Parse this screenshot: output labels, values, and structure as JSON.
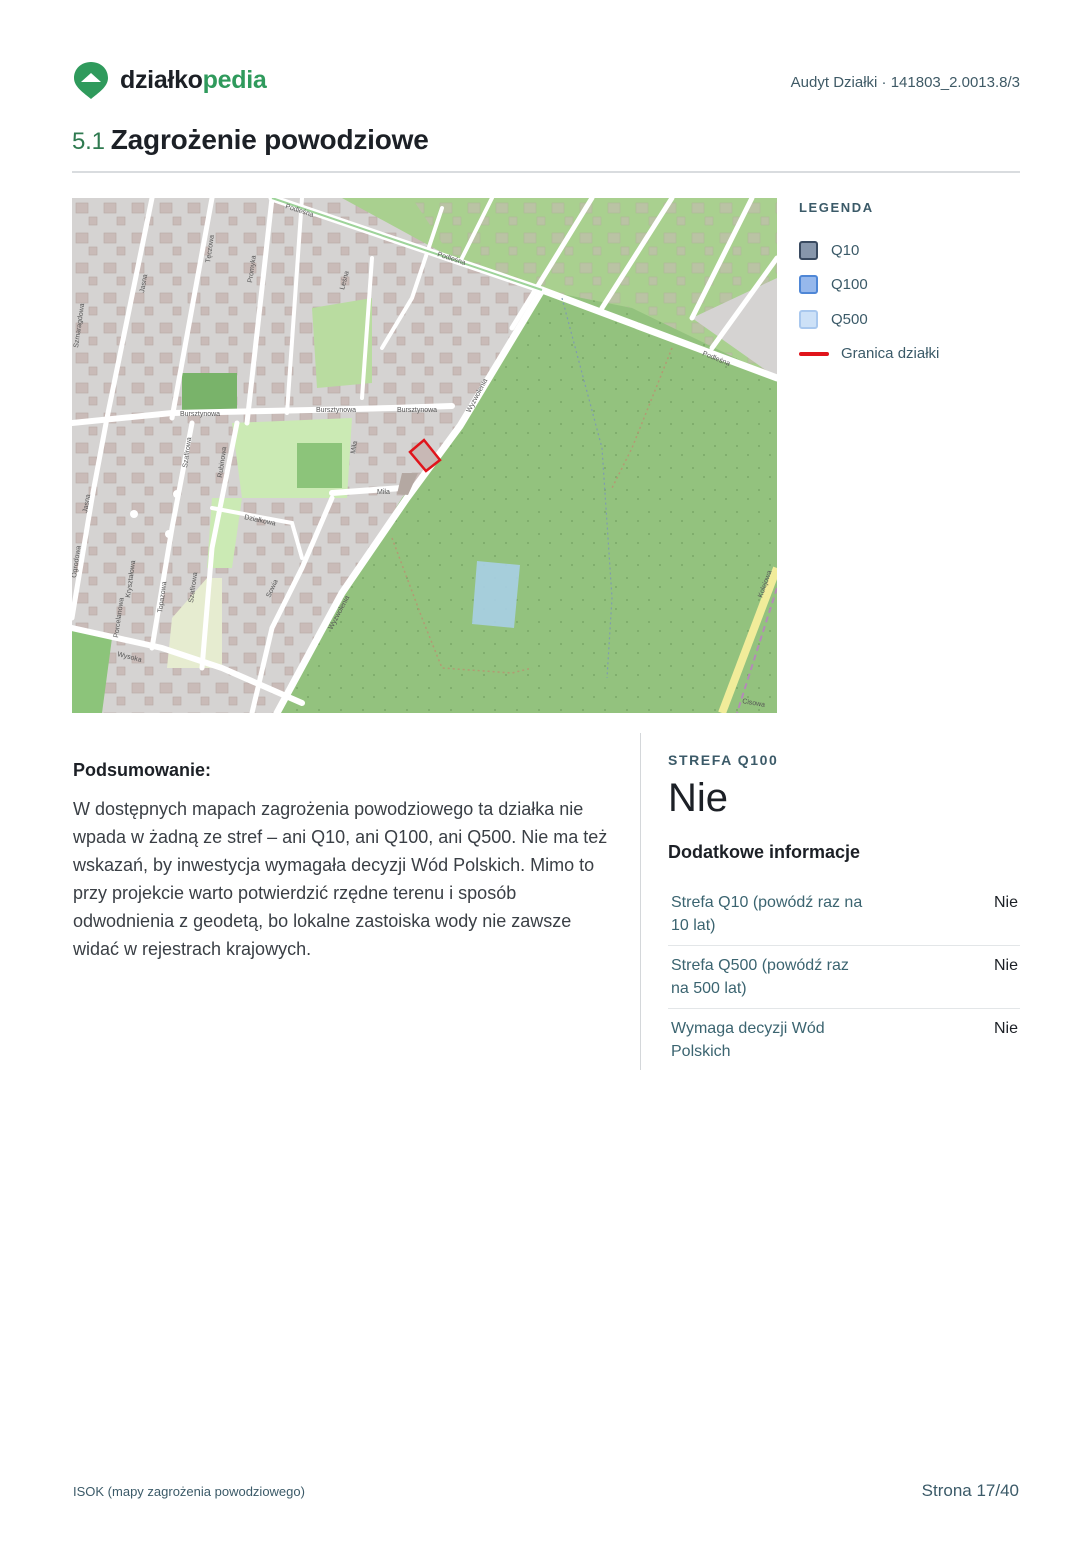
{
  "header": {
    "logo_part1": "działko",
    "logo_part2": "pedia",
    "doc_ref": "Audyt Działki · 141803_2.0013.8/3"
  },
  "section": {
    "number": "5.1",
    "title": "Zagrożenie powodziowe"
  },
  "map": {
    "street_labels": [
      "Podleśna",
      "Podleśna",
      "Podleśna",
      "Bursztynowa",
      "Bursztynowa",
      "Bursztynowa",
      "Miła",
      "Miła",
      "Działkowa",
      "Wysoka",
      "Wyzwolenia",
      "Wyzwolenia",
      "Szafirowa",
      "Szafirowa",
      "Topazowa",
      "Kryształowa",
      "Porcelanowa",
      "Jasna",
      "Jasna",
      "Promyka",
      "Tęczowa",
      "Rubinowa",
      "Sowia",
      "Szmaragdowa",
      "Kolejowa",
      "Leśna",
      "Cisowa",
      "Ogrodowa"
    ],
    "colors": {
      "forest": "#93c27e",
      "residential": "#d5d3d2",
      "road": "#ffffff",
      "parcel_border": "#e0141b",
      "water_zone": "#a9cfe6"
    }
  },
  "legend": {
    "title": "LEGENDA",
    "items": [
      {
        "label": "Q10",
        "color": "#8796ab"
      },
      {
        "label": "Q100",
        "color": "#96b8ec"
      },
      {
        "label": "Q500",
        "color": "#cde1f7"
      },
      {
        "label": "Granica działki",
        "color": "#e0141b"
      }
    ]
  },
  "summary": {
    "heading": "Podsumowanie:",
    "text": "W dostępnych mapach zagrożenia powodziowego ta działka nie wpada w żadną ze stref – ani Q10, ani Q100, ani Q500. Nie ma też wskazań, by inwestycja wymagała decyzji Wód Polskich. Mimo to przy projekcie warto potwierdzić rzędne terenu i sposób odwodnienia z geodetą, bo lokalne zastoiska wody nie zawsze widać w rejestrach krajowych."
  },
  "zone": {
    "label": "STREFA Q100",
    "value": "Nie"
  },
  "additional": {
    "title": "Dodatkowe informacje",
    "rows": [
      {
        "key": "Strefa Q10 (powódź raz na 10 lat)",
        "value": "Nie"
      },
      {
        "key": "Strefa Q500 (powódź raz na 500 lat)",
        "value": "Nie"
      },
      {
        "key": "Wymaga decyzji Wód Polskich",
        "value": "Nie"
      }
    ]
  },
  "footer": {
    "source": "ISOK (mapy zagrożenia powodziowego)",
    "page": "Strona 17/40"
  }
}
